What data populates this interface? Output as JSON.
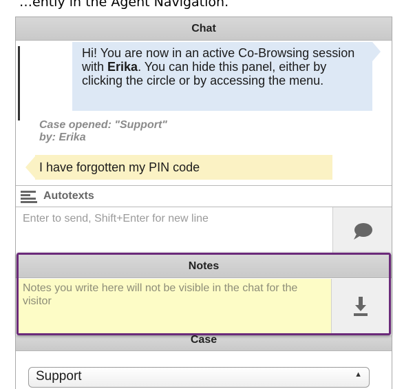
{
  "caption": "…ently in the Agent Navigation.",
  "chat": {
    "header": "Chat",
    "agent_message": {
      "before": "Hi! You are now in an active Co-Browsing session with ",
      "name": "Erika",
      "after": ". You can hide this panel, either by clicking the circle or by accessing the menu."
    },
    "system_line1": "Case opened: \"Support\"",
    "system_line2": "by: Erika",
    "visitor_message": "I have forgotten my PIN code"
  },
  "autotexts": {
    "label": "Autotexts",
    "icon": "list-icon"
  },
  "input": {
    "placeholder": "Enter to send, Shift+Enter for new line",
    "send_icon": "speech-bubble-icon"
  },
  "notes": {
    "header": "Notes",
    "placeholder": "Notes you write here will not be visible in the chat for the visitor",
    "save_icon": "download-icon",
    "highlight_color": "#6b2a7a"
  },
  "case": {
    "header": "Case",
    "selected": "Support"
  },
  "colors": {
    "agent_bubble": "#dde8f5",
    "visitor_bubble": "#fbf2c4",
    "notes_background": "#fdfcc6"
  }
}
